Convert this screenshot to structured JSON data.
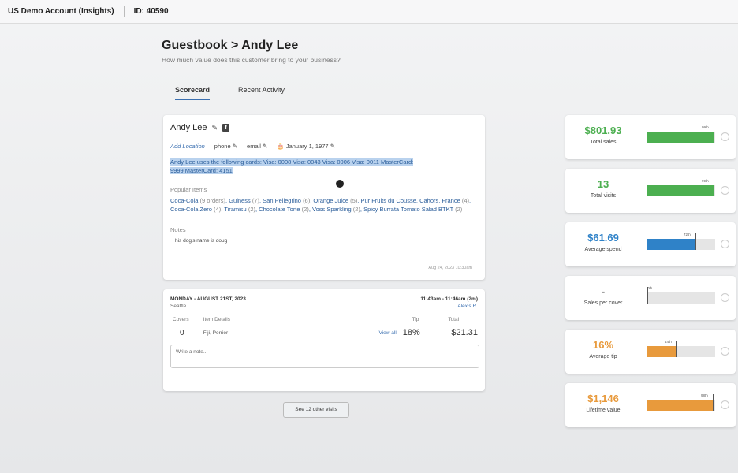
{
  "topbar": {
    "account": "US Demo Account (Insights)",
    "id": "ID: 40590"
  },
  "page": {
    "title": "Guestbook > Andy Lee",
    "subtitle": "How much value does this customer bring to your business?"
  },
  "tabs": [
    {
      "label": "Scorecard",
      "active": true
    },
    {
      "label": "Recent Activity",
      "active": false
    }
  ],
  "profile": {
    "name": "Andy Lee",
    "add_location": "Add Location",
    "phone": "phone",
    "email": "email",
    "birthday": "January 1, 1977",
    "cards_note": "Andy Lee uses the following cards: Visa: 0008 Visa: 0043 Visa: 0006 Visa: 0011 MasterCard: 9999 MasterCard: 4151",
    "popular_label": "Popular Items",
    "popular_items": [
      {
        "name": "Coca-Cola",
        "count": "(9 orders)"
      },
      {
        "name": "Guiness",
        "count": "(7)"
      },
      {
        "name": "San Pellegrino",
        "count": "(6)"
      },
      {
        "name": "Orange Juice",
        "count": "(5)"
      },
      {
        "name": "Pur Fruits du Cousse, Cahors, France",
        "count": "(4)"
      },
      {
        "name": "Coca-Cola Zero",
        "count": "(4)"
      },
      {
        "name": "Tiramisu",
        "count": "(2)"
      },
      {
        "name": "Chocolate Torte",
        "count": "(2)"
      },
      {
        "name": "Voss Sparkling",
        "count": "(2)"
      },
      {
        "name": "Spicy Burrata Tomato Salad BTKT",
        "count": "(2)"
      }
    ],
    "notes_label": "Notes",
    "note_text": "his dog's name is doug",
    "note_date": "Aug 24, 2023 10:30am"
  },
  "visit": {
    "date": "MONDAY - AUGUST 21ST, 2023",
    "time": "11:43am - 11:46am (2m)",
    "location": "Seattle",
    "server": "Alexis R.",
    "col_covers": "Covers",
    "col_items": "Item Details",
    "col_tip": "Tip",
    "col_total": "Total",
    "covers": "0",
    "items": "Fiji, Perrier",
    "view_all": "View all",
    "tip": "18%",
    "total": "$21.31",
    "note_placeholder": "Write a note..."
  },
  "more_visits": "See 12 other visits",
  "stats": [
    {
      "value": "$801.93",
      "label": "Total sales",
      "color": "#4caf50",
      "percentile": 0.99,
      "pct_label": "99th"
    },
    {
      "value": "13",
      "label": "Total visits",
      "color": "#4caf50",
      "percentile": 0.99,
      "pct_label": "99th"
    },
    {
      "value": "$61.69",
      "label": "Average spend",
      "color": "#2f82c8",
      "percentile": 0.72,
      "pct_label": "72th"
    },
    {
      "value": "-",
      "label": "Sales per cover",
      "color": "#2f82c8",
      "percentile": 0.0,
      "pct_label": "0th"
    },
    {
      "value": "16%",
      "label": "Average tip",
      "color": "#e89a3c",
      "percentile": 0.44,
      "pct_label": "44th"
    },
    {
      "value": "$1,146",
      "label": "Lifetime value",
      "color": "#e89a3c",
      "percentile": 0.98,
      "pct_label": "98th"
    }
  ]
}
